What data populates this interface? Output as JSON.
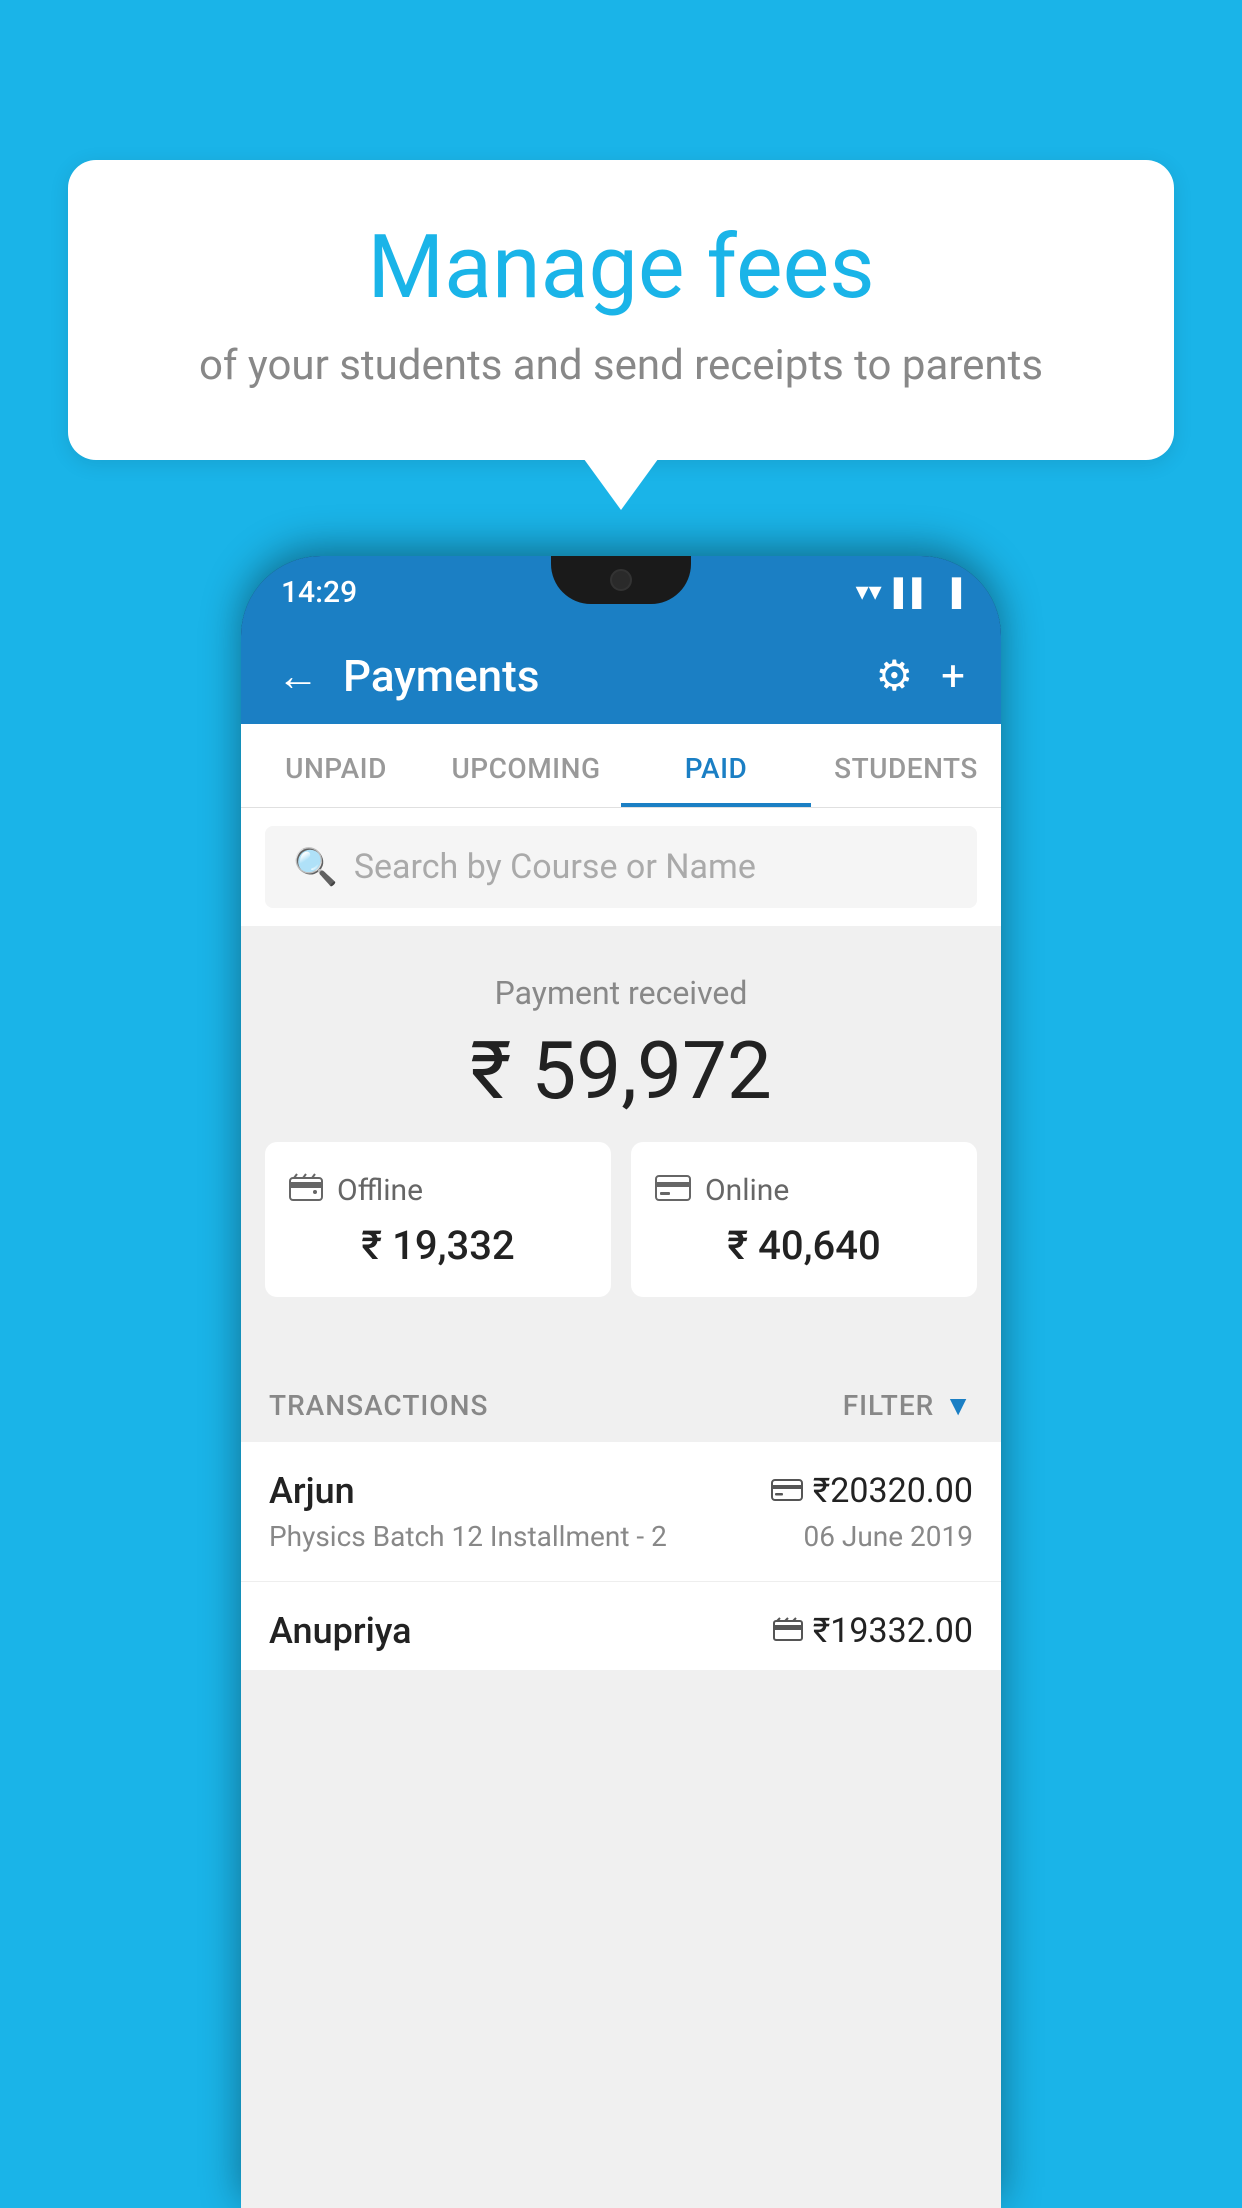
{
  "background": {
    "color": "#1ab4e8"
  },
  "speech_bubble": {
    "title": "Manage fees",
    "subtitle": "of your students and send receipts to parents"
  },
  "status_bar": {
    "time": "14:29",
    "icons": [
      "wifi",
      "signal",
      "battery"
    ]
  },
  "app_header": {
    "title": "Payments",
    "back_label": "←",
    "settings_label": "⚙",
    "add_label": "+"
  },
  "tabs": [
    {
      "label": "UNPAID",
      "active": false
    },
    {
      "label": "UPCOMING",
      "active": false
    },
    {
      "label": "PAID",
      "active": true
    },
    {
      "label": "STUDENTS",
      "active": false
    }
  ],
  "search": {
    "placeholder": "Search by Course or Name"
  },
  "payment_summary": {
    "label": "Payment received",
    "total_amount": "₹ 59,972",
    "offline_label": "Offline",
    "offline_amount": "₹ 19,332",
    "online_label": "Online",
    "online_amount": "₹ 40,640"
  },
  "transactions_section": {
    "label": "TRANSACTIONS",
    "filter_label": "FILTER"
  },
  "transactions": [
    {
      "name": "Arjun",
      "course": "Physics Batch 12 Installment - 2",
      "amount": "₹20320.00",
      "date": "06 June 2019",
      "payment_type": "online"
    },
    {
      "name": "Anupriya",
      "course": "",
      "amount": "₹19332.00",
      "date": "",
      "payment_type": "offline"
    }
  ]
}
